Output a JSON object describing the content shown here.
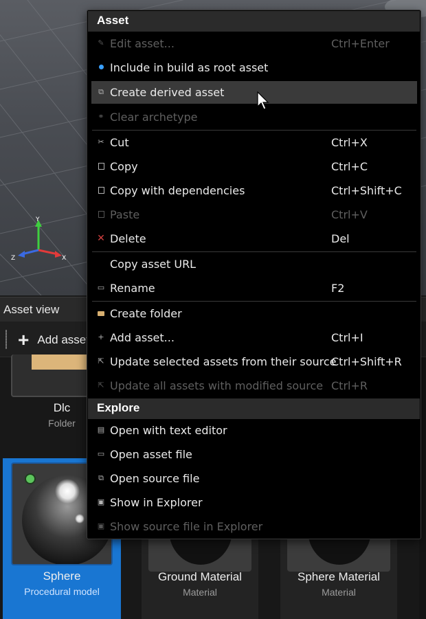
{
  "viewport": {
    "axes": {
      "y": "Y",
      "x": "X",
      "z": "Z"
    }
  },
  "asset_view": {
    "title": "Asset view",
    "toolbar": {
      "add_label": "Add asset"
    }
  },
  "tiles": [
    {
      "name": "Dlc",
      "type": "Folder"
    },
    {
      "name": "Sphere",
      "type": "Procedural model"
    },
    {
      "name": "Ground Material",
      "type": "Material"
    },
    {
      "name": "Sphere Material",
      "type": "Material"
    }
  ],
  "menu": {
    "asset_header": "Asset",
    "items": [
      {
        "label": "Edit asset...",
        "shortcut": "Ctrl+Enter",
        "icon": "pencil-icon",
        "enabled": false
      },
      {
        "label": "Include in build as root asset",
        "shortcut": "",
        "icon": "blue-dot-icon",
        "enabled": true
      },
      {
        "label": "Create derived asset",
        "shortcut": "",
        "icon": "derive-icon",
        "enabled": true,
        "hover": true
      },
      {
        "label": "Clear archetype",
        "shortcut": "",
        "icon": "archetype-icon",
        "enabled": false
      },
      {
        "label": "Cut",
        "shortcut": "Ctrl+X",
        "icon": "scissors-icon",
        "enabled": true
      },
      {
        "label": "Copy",
        "shortcut": "Ctrl+C",
        "icon": "copy-icon",
        "enabled": true
      },
      {
        "label": "Copy with dependencies",
        "shortcut": "Ctrl+Shift+C",
        "icon": "copy-icon",
        "enabled": true
      },
      {
        "label": "Paste",
        "shortcut": "Ctrl+V",
        "icon": "paste-icon",
        "enabled": false
      },
      {
        "label": "Delete",
        "shortcut": "Del",
        "icon": "delete-icon",
        "enabled": true
      },
      {
        "label": "Copy asset URL",
        "shortcut": "",
        "icon": "",
        "enabled": true
      },
      {
        "label": "Rename",
        "shortcut": "F2",
        "icon": "rename-icon",
        "enabled": true
      },
      {
        "label": "Create folder",
        "shortcut": "",
        "icon": "folder-icon",
        "enabled": true
      },
      {
        "label": "Add asset...",
        "shortcut": "Ctrl+I",
        "icon": "add-icon",
        "enabled": true
      },
      {
        "label": "Update selected assets from their source",
        "shortcut": "Ctrl+Shift+R",
        "icon": "update-icon",
        "enabled": true
      },
      {
        "label": "Update all assets with modified source",
        "shortcut": "Ctrl+R",
        "icon": "update-icon",
        "enabled": false
      }
    ],
    "explore_header": "Explore",
    "explore_items": [
      {
        "label": "Open with text editor",
        "icon": "text-editor-icon",
        "enabled": true
      },
      {
        "label": "Open asset file",
        "icon": "asset-file-icon",
        "enabled": true
      },
      {
        "label": "Open source file",
        "icon": "source-file-icon",
        "enabled": true
      },
      {
        "label": "Show in Explorer",
        "icon": "explorer-icon",
        "enabled": true
      },
      {
        "label": "Show source file in Explorer",
        "icon": "explorer-icon",
        "enabled": false
      }
    ]
  },
  "colors": {
    "selection": "#1976d2",
    "folder": "#dcb57a",
    "status_ok": "#5cc45c",
    "delete": "#d24040",
    "root_dot": "#3aa0ff"
  }
}
